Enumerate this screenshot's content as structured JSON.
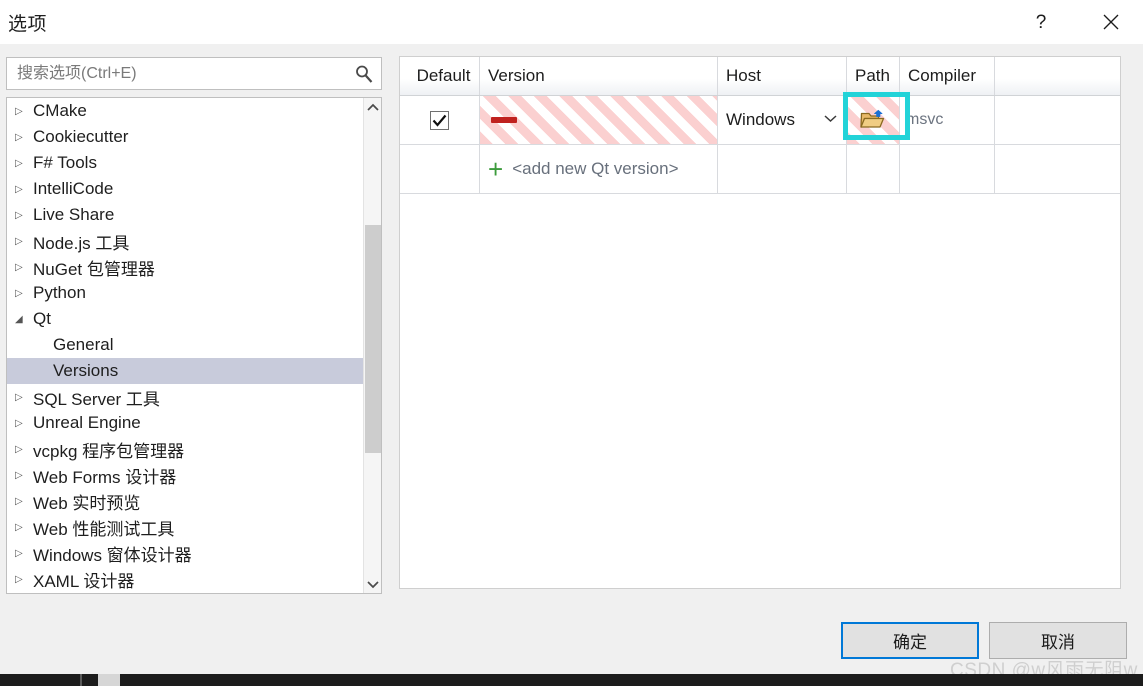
{
  "window": {
    "title": "选项",
    "help_label": "?",
    "close_label": "×"
  },
  "search": {
    "placeholder": "搜索选项(Ctrl+E)",
    "value": "",
    "icon": "search-icon"
  },
  "tree": {
    "scrollbar": {
      "up_arrow": "︿",
      "down_arrow": "﹀"
    },
    "items": [
      {
        "label": "CMake",
        "expander": "▷",
        "level": 0,
        "selected": false
      },
      {
        "label": "Cookiecutter",
        "expander": "▷",
        "level": 0,
        "selected": false
      },
      {
        "label": "F# Tools",
        "expander": "▷",
        "level": 0,
        "selected": false
      },
      {
        "label": "IntelliCode",
        "expander": "▷",
        "level": 0,
        "selected": false
      },
      {
        "label": "Live Share",
        "expander": "▷",
        "level": 0,
        "selected": false
      },
      {
        "label": "Node.js 工具",
        "expander": "▷",
        "level": 0,
        "selected": false
      },
      {
        "label": "NuGet 包管理器",
        "expander": "▷",
        "level": 0,
        "selected": false
      },
      {
        "label": "Python",
        "expander": "▷",
        "level": 0,
        "selected": false
      },
      {
        "label": "Qt",
        "expander": "◢",
        "level": 0,
        "selected": false
      },
      {
        "label": "General",
        "expander": "",
        "level": 1,
        "selected": false
      },
      {
        "label": "Versions",
        "expander": "",
        "level": 1,
        "selected": true
      },
      {
        "label": "SQL Server 工具",
        "expander": "▷",
        "level": 0,
        "selected": false
      },
      {
        "label": "Unreal Engine",
        "expander": "▷",
        "level": 0,
        "selected": false
      },
      {
        "label": "vcpkg 程序包管理器",
        "expander": "▷",
        "level": 0,
        "selected": false
      },
      {
        "label": "Web Forms 设计器",
        "expander": "▷",
        "level": 0,
        "selected": false
      },
      {
        "label": "Web 实时预览",
        "expander": "▷",
        "level": 0,
        "selected": false
      },
      {
        "label": "Web 性能测试工具",
        "expander": "▷",
        "level": 0,
        "selected": false
      },
      {
        "label": "Windows 窗体设计器",
        "expander": "▷",
        "level": 0,
        "selected": false
      },
      {
        "label": "XAML 设计器",
        "expander": "▷",
        "level": 0,
        "selected": false
      }
    ]
  },
  "grid": {
    "headers": {
      "default": "Default",
      "version": "Version",
      "host": "Host",
      "path": "Path",
      "compiler": "Compiler",
      "extra": ""
    },
    "row": {
      "default_checked": true,
      "version_value": "",
      "version_redacted": true,
      "host_value": "Windows",
      "host_chevron": "⌄",
      "path_icon": "folder-open-icon",
      "compiler_value": "msvc"
    },
    "add_row": {
      "plus": "+",
      "label": "<add new Qt version>"
    }
  },
  "highlight": {
    "color": "#22d3d8",
    "target": "path-browse-button"
  },
  "buttons": {
    "ok": "确定",
    "cancel": "取消"
  },
  "watermark": {
    "text": "CSDN @w风雨无阻w"
  }
}
